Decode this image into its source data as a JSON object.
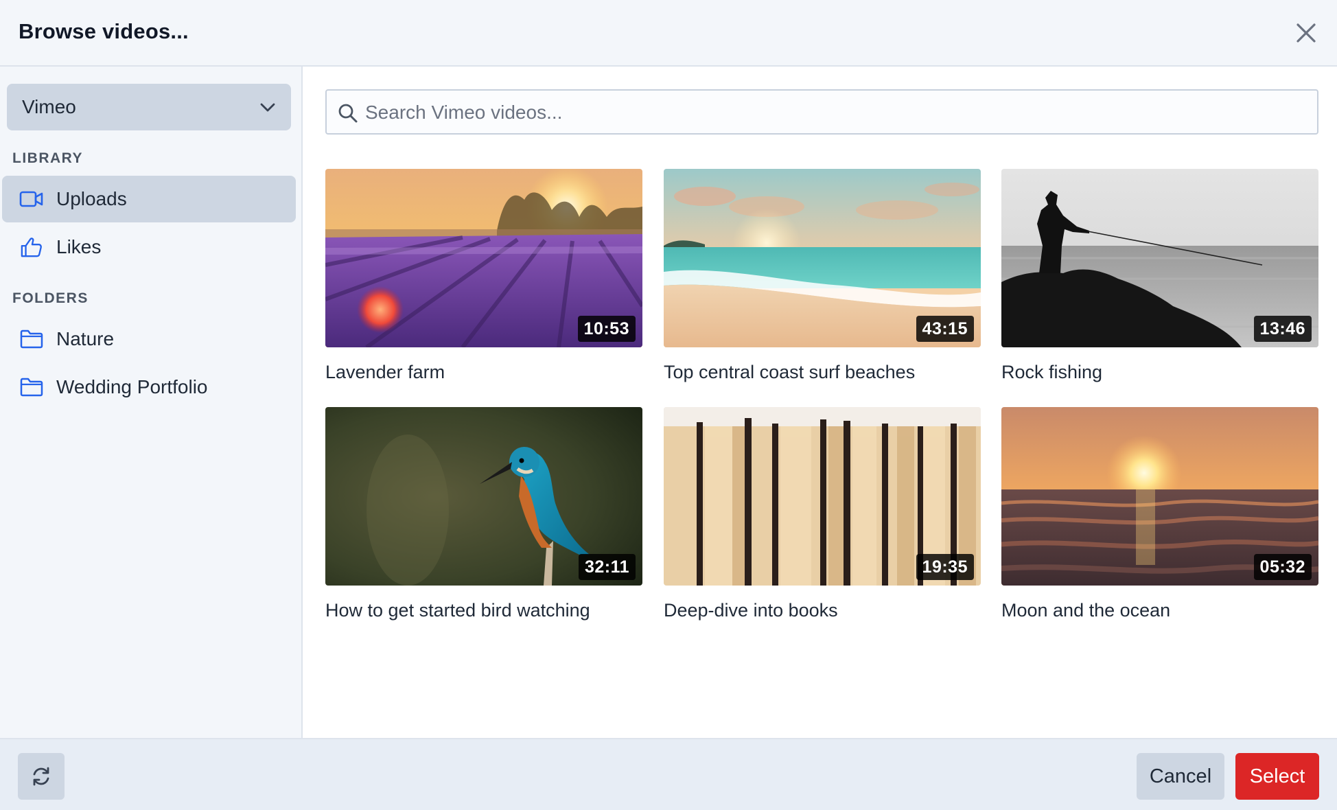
{
  "header": {
    "title": "Browse videos...",
    "close_icon": "close-icon"
  },
  "sidebar": {
    "source_select": {
      "value": "Vimeo"
    },
    "library_heading": "LIBRARY",
    "library_items": [
      {
        "label": "Uploads",
        "icon": "video-camera-icon",
        "active": true
      },
      {
        "label": "Likes",
        "icon": "thumbs-up-icon",
        "active": false
      }
    ],
    "folders_heading": "FOLDERS",
    "folder_items": [
      {
        "label": "Nature",
        "icon": "folder-icon"
      },
      {
        "label": "Wedding Portfolio",
        "icon": "folder-icon"
      }
    ]
  },
  "search": {
    "placeholder": "Search Vimeo videos...",
    "value": ""
  },
  "videos": [
    {
      "title": "Lavender farm",
      "duration": "10:53"
    },
    {
      "title": "Top central coast surf beaches",
      "duration": "43:15"
    },
    {
      "title": "Rock fishing",
      "duration": "13:46"
    },
    {
      "title": "How to get started bird watching",
      "duration": "32:11"
    },
    {
      "title": "Deep-dive into books",
      "duration": "19:35"
    },
    {
      "title": "Moon and the ocean",
      "duration": "05:32"
    }
  ],
  "footer": {
    "refresh_icon": "refresh-icon",
    "cancel_label": "Cancel",
    "select_label": "Select"
  },
  "colors": {
    "accent": "#dc2626",
    "icon_blue": "#2563eb",
    "active_bg": "#cdd6e2"
  }
}
